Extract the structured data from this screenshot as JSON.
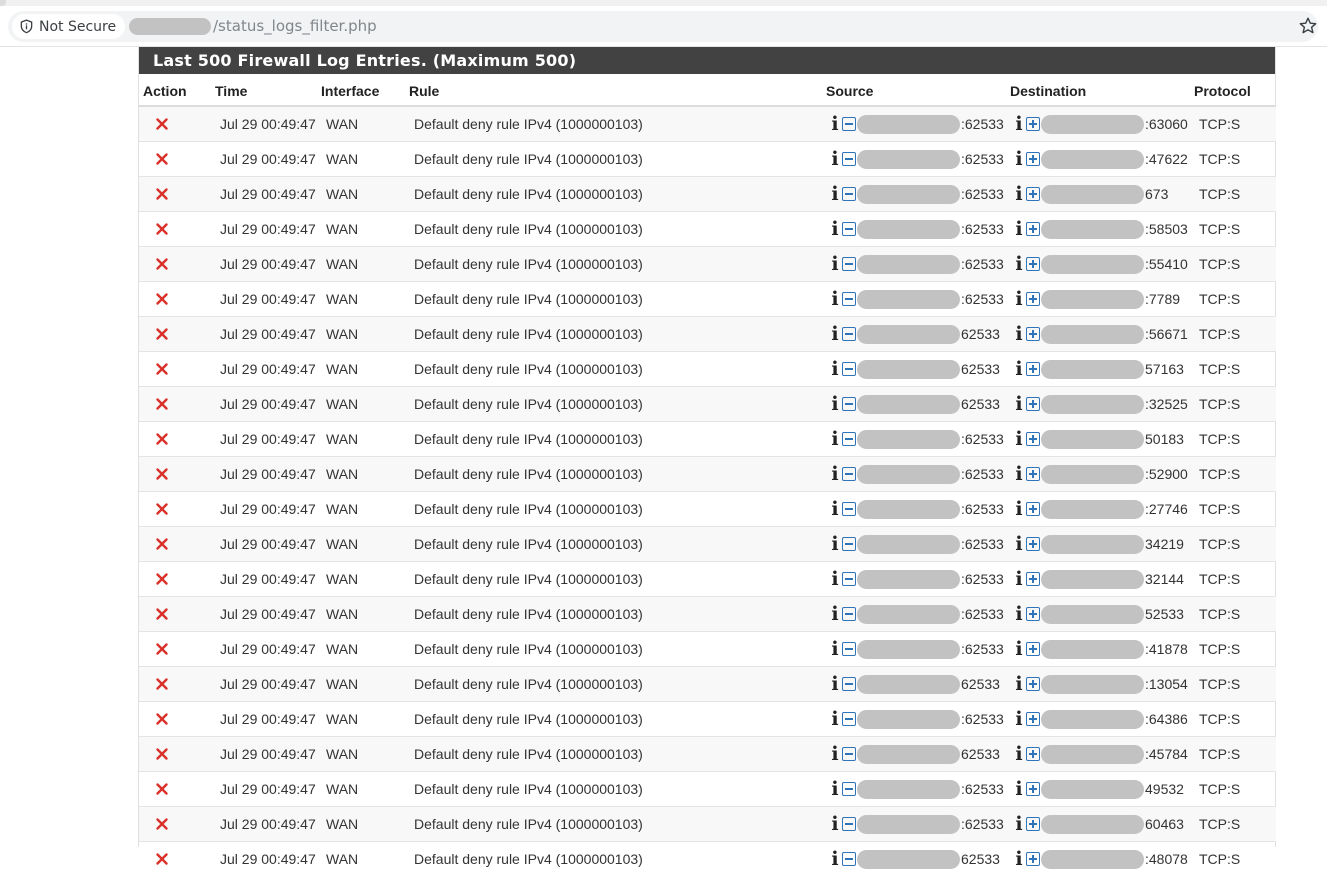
{
  "browser": {
    "security_label": "Not Secure",
    "url_path": "/status_logs_filter.php"
  },
  "panel": {
    "title": "Last 500 Firewall Log Entries. (Maximum 500)"
  },
  "table": {
    "headers": [
      "Action",
      "Time",
      "Interface",
      "Rule",
      "Source",
      "Destination",
      "Protocol"
    ],
    "rows": [
      {
        "time": "Jul 29 00:49:47",
        "iface": "WAN",
        "rule": "Default deny rule IPv4 (1000000103)",
        "src_port": ":62533",
        "dst_port": ":63060",
        "proto": "TCP:S"
      },
      {
        "time": "Jul 29 00:49:47",
        "iface": "WAN",
        "rule": "Default deny rule IPv4 (1000000103)",
        "src_port": ":62533",
        "dst_port": ":47622",
        "proto": "TCP:S"
      },
      {
        "time": "Jul 29 00:49:47",
        "iface": "WAN",
        "rule": "Default deny rule IPv4 (1000000103)",
        "src_port": ":62533",
        "dst_port": "673",
        "proto": "TCP:S"
      },
      {
        "time": "Jul 29 00:49:47",
        "iface": "WAN",
        "rule": "Default deny rule IPv4 (1000000103)",
        "src_port": ":62533",
        "dst_port": ":58503",
        "proto": "TCP:S"
      },
      {
        "time": "Jul 29 00:49:47",
        "iface": "WAN",
        "rule": "Default deny rule IPv4 (1000000103)",
        "src_port": ":62533",
        "dst_port": ":55410",
        "proto": "TCP:S"
      },
      {
        "time": "Jul 29 00:49:47",
        "iface": "WAN",
        "rule": "Default deny rule IPv4 (1000000103)",
        "src_port": ":62533",
        "dst_port": ":7789",
        "proto": "TCP:S"
      },
      {
        "time": "Jul 29 00:49:47",
        "iface": "WAN",
        "rule": "Default deny rule IPv4 (1000000103)",
        "src_port": "62533",
        "dst_port": ":56671",
        "proto": "TCP:S"
      },
      {
        "time": "Jul 29 00:49:47",
        "iface": "WAN",
        "rule": "Default deny rule IPv4 (1000000103)",
        "src_port": "62533",
        "dst_port": "57163",
        "proto": "TCP:S"
      },
      {
        "time": "Jul 29 00:49:47",
        "iface": "WAN",
        "rule": "Default deny rule IPv4 (1000000103)",
        "src_port": "62533",
        "dst_port": ":32525",
        "proto": "TCP:S"
      },
      {
        "time": "Jul 29 00:49:47",
        "iface": "WAN",
        "rule": "Default deny rule IPv4 (1000000103)",
        "src_port": ":62533",
        "dst_port": "50183",
        "proto": "TCP:S"
      },
      {
        "time": "Jul 29 00:49:47",
        "iface": "WAN",
        "rule": "Default deny rule IPv4 (1000000103)",
        "src_port": ":62533",
        "dst_port": ":52900",
        "proto": "TCP:S"
      },
      {
        "time": "Jul 29 00:49:47",
        "iface": "WAN",
        "rule": "Default deny rule IPv4 (1000000103)",
        "src_port": ":62533",
        "dst_port": ":27746",
        "proto": "TCP:S"
      },
      {
        "time": "Jul 29 00:49:47",
        "iface": "WAN",
        "rule": "Default deny rule IPv4 (1000000103)",
        "src_port": ":62533",
        "dst_port": "34219",
        "proto": "TCP:S"
      },
      {
        "time": "Jul 29 00:49:47",
        "iface": "WAN",
        "rule": "Default deny rule IPv4 (1000000103)",
        "src_port": ":62533",
        "dst_port": "32144",
        "proto": "TCP:S"
      },
      {
        "time": "Jul 29 00:49:47",
        "iface": "WAN",
        "rule": "Default deny rule IPv4 (1000000103)",
        "src_port": ":62533",
        "dst_port": "52533",
        "proto": "TCP:S"
      },
      {
        "time": "Jul 29 00:49:47",
        "iface": "WAN",
        "rule": "Default deny rule IPv4 (1000000103)",
        "src_port": ":62533",
        "dst_port": ":41878",
        "proto": "TCP:S"
      },
      {
        "time": "Jul 29 00:49:47",
        "iface": "WAN",
        "rule": "Default deny rule IPv4 (1000000103)",
        "src_port": "62533",
        "dst_port": ":13054",
        "proto": "TCP:S"
      },
      {
        "time": "Jul 29 00:49:47",
        "iface": "WAN",
        "rule": "Default deny rule IPv4 (1000000103)",
        "src_port": ":62533",
        "dst_port": ":64386",
        "proto": "TCP:S"
      },
      {
        "time": "Jul 29 00:49:47",
        "iface": "WAN",
        "rule": "Default deny rule IPv4 (1000000103)",
        "src_port": "62533",
        "dst_port": ":45784",
        "proto": "TCP:S"
      },
      {
        "time": "Jul 29 00:49:47",
        "iface": "WAN",
        "rule": "Default deny rule IPv4 (1000000103)",
        "src_port": ":62533",
        "dst_port": "49532",
        "proto": "TCP:S"
      },
      {
        "time": "Jul 29 00:49:47",
        "iface": "WAN",
        "rule": "Default deny rule IPv4 (1000000103)",
        "src_port": ":62533",
        "dst_port": "60463",
        "proto": "TCP:S"
      },
      {
        "time": "Jul 29 00:49:47",
        "iface": "WAN",
        "rule": "Default deny rule IPv4 (1000000103)",
        "src_port": "62533",
        "dst_port": ":48078",
        "proto": "TCP:S"
      }
    ]
  },
  "colors": {
    "heading_bg": "#424242",
    "block_red": "#d9302a",
    "icon_blue": "#2f73b8"
  },
  "icons": {
    "action": "x-block-icon",
    "info": "info-icon",
    "source_toggle": "minus-square-icon",
    "destination_toggle": "plus-square-icon",
    "bookmark": "star-icon"
  }
}
